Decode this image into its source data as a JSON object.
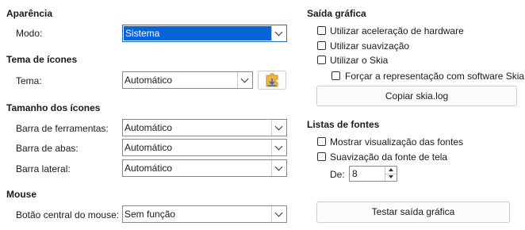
{
  "appearance": {
    "title": "Aparência",
    "mode_label": "Modo:",
    "mode_value": "Sistema"
  },
  "icon_theme": {
    "title": "Tema de ícones",
    "theme_label": "Tema:",
    "theme_value": "Automático"
  },
  "icon_size": {
    "title": "Tamanho dos ícones",
    "toolbar_label": "Barra de ferramentas:",
    "toolbar_value": "Automático",
    "tabbar_label": "Barra de abas:",
    "tabbar_value": "Automático",
    "sidebar_label": "Barra lateral:",
    "sidebar_value": "Automático"
  },
  "mouse": {
    "title": "Mouse",
    "middle_label": "Botão central do mouse:",
    "middle_value": "Sem função"
  },
  "graphics": {
    "title": "Saída gráfica",
    "hw_accel": "Utilizar aceleração de hardware",
    "antialias": "Utilizar suavização",
    "skia": "Utilizar o Skia",
    "skia_software": "Forçar a representação com software Skia",
    "copy_button": "Copiar skia.log"
  },
  "font_lists": {
    "title": "Listas de fontes",
    "preview": "Mostrar visualização das fontes",
    "smoothing": "Suavização da fonte de tela",
    "from_label": "De:",
    "from_value": "8",
    "test_button": "Testar saída gráfica"
  },
  "colors": {
    "selection": "#0a64d8",
    "border": "#8a8a8a"
  },
  "icons": {
    "add_theme": "add-extension-icon"
  }
}
